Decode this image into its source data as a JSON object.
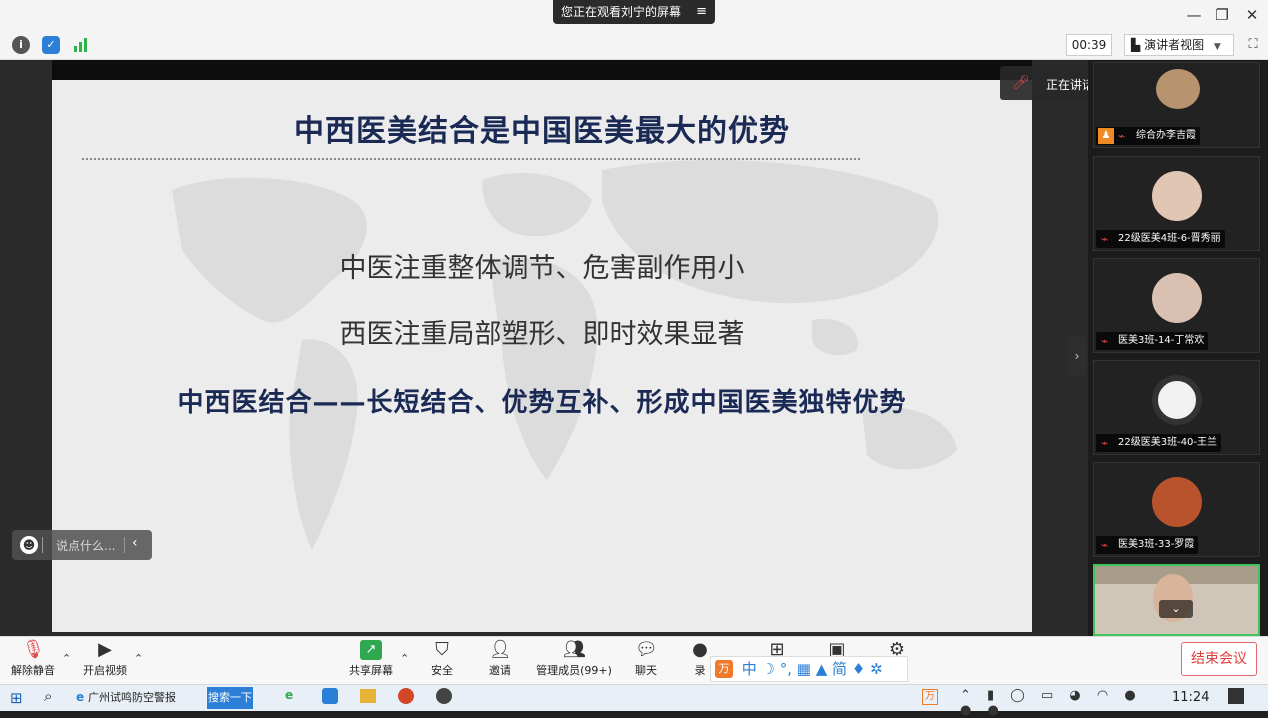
{
  "window": {
    "share_banner": "您正在观看刘宁的屏幕",
    "minimize": "—",
    "restore": "❐",
    "close": "✕"
  },
  "infobar": {
    "timer": "00:39",
    "view_label": "演讲者视图"
  },
  "slide": {
    "title": "中西医美结合是中国医美最大的优势",
    "line1": "中医注重整体调节、危害副作用小",
    "line2": "西医注重局部塑形、即时效果显著",
    "line3": "中西医结合——长短结合、优势互补、形成中国医美独特优势"
  },
  "chat": {
    "placeholder": "说点什么..."
  },
  "speaker": {
    "text": "正在讲话: 刘宁;"
  },
  "gallery": [
    {
      "name": "综合办李吉霞"
    },
    {
      "name": "22级医美4班-6-晋秀丽"
    },
    {
      "name": "医美3班-14-丁常欢"
    },
    {
      "name": "22级医美3班-40-王兰"
    },
    {
      "name": "医美3班-33-罗霞"
    }
  ],
  "toolbar": {
    "mute": "解除静音",
    "video": "开启视频",
    "share": "共享屏幕",
    "security": "安全",
    "invite": "邀请",
    "members": "管理成员(99+)",
    "chat": "聊天",
    "record": "录",
    "end": "结束会议"
  },
  "ime": {
    "text": "中 ☽ °, ▦ ▲ 简 ♦ ✲"
  },
  "taskbar": {
    "ie_label": "广州试鸣防空警报",
    "search": "搜索一下",
    "clock": "11:24"
  },
  "colors": {
    "slide_title": "#1a2a55",
    "end_button": "#e03c3c",
    "accent": "#2b7fd6"
  }
}
